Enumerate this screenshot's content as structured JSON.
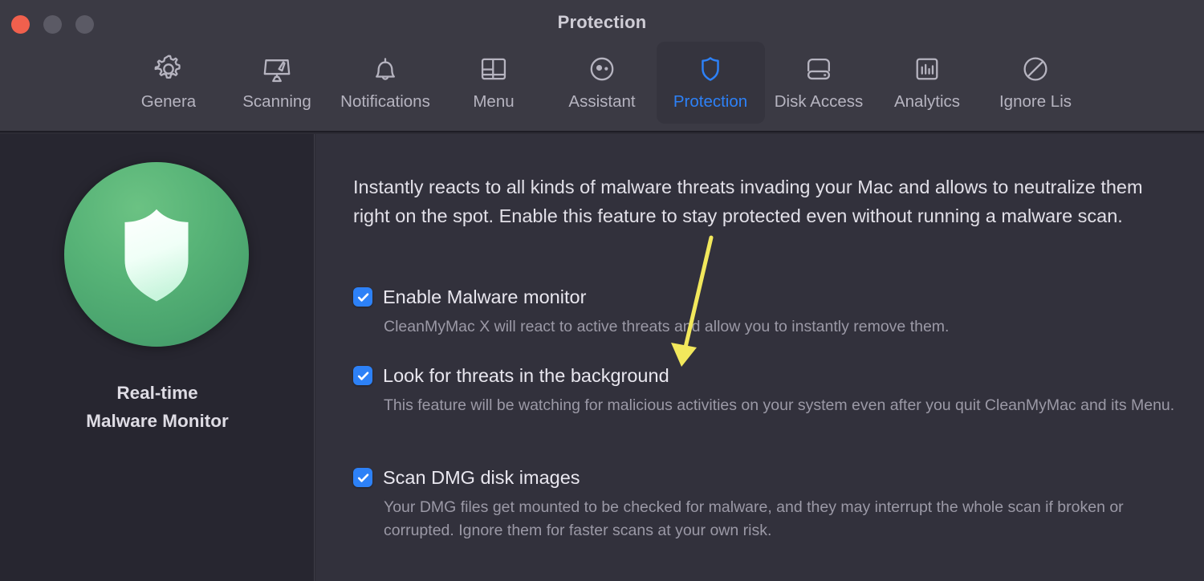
{
  "window": {
    "title": "Protection",
    "traffic_lights": [
      {
        "name": "close",
        "color": "#f0604d"
      },
      {
        "name": "minimize",
        "color": "#5b5a65"
      },
      {
        "name": "zoom",
        "color": "#5b5a65"
      }
    ]
  },
  "toolbar": {
    "selected": "Protection",
    "accent_color": "#2d81f7",
    "items": [
      {
        "label": "Genera",
        "icon": "gear-icon"
      },
      {
        "label": "Scanning",
        "icon": "monitor-brush-icon"
      },
      {
        "label": "Notifications",
        "icon": "bell-icon"
      },
      {
        "label": "Menu",
        "icon": "layout-panels-icon"
      },
      {
        "label": "Assistant",
        "icon": "assistant-face-icon"
      },
      {
        "label": "Protection",
        "icon": "shield-icon"
      },
      {
        "label": "Disk Access",
        "icon": "hard-drive-icon"
      },
      {
        "label": "Analytics",
        "icon": "bar-chart-icon"
      },
      {
        "label": "Ignore Lis",
        "icon": "no-entry-icon"
      }
    ]
  },
  "sidebar": {
    "badge_icon": "shield-icon",
    "badge_color": "#4fae76",
    "title_line1": "Real-time",
    "title_line2": "Malware Monitor"
  },
  "main": {
    "intro": "Instantly reacts to all kinds of malware threats invading your Mac and allows to neutralize them right on the spot. Enable this feature to stay protected even without running a malware scan.",
    "options": [
      {
        "label": "Enable Malware monitor",
        "checked": true,
        "description": "CleanMyMac X will react to active threats and allow you to instantly remove them."
      },
      {
        "label": "Look for threats in the background",
        "checked": true,
        "description": "This feature will be watching for malicious activities on your system even after you quit CleanMyMac and its Menu."
      },
      {
        "label": "Scan DMG disk images",
        "checked": true,
        "description": "Your DMG files get mounted to be checked for malware, and they may interrupt the whole scan if broken or corrupted. Ignore them for faster scans at your own risk."
      }
    ]
  },
  "annotation": {
    "type": "arrow",
    "color": "#f2e85c",
    "points_to": "Look for threats in the background"
  }
}
